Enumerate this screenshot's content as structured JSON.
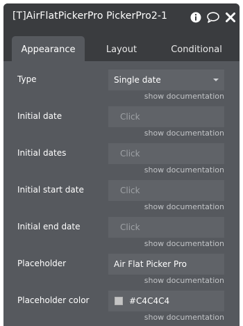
{
  "window": {
    "title": "[T]AirFlatPickerPro PickerPro2-1",
    "icons": [
      "info-icon",
      "comment-icon",
      "close-icon"
    ]
  },
  "tabs": [
    {
      "label": "Appearance",
      "active": true
    },
    {
      "label": "Layout",
      "active": false
    },
    {
      "label": "Conditional",
      "active": false
    }
  ],
  "properties": {
    "type": {
      "label": "Type",
      "value": "Single date",
      "doc": "show documentation"
    },
    "initial_date": {
      "label": "Initial date",
      "placeholder": "Click",
      "doc": "show documentation"
    },
    "initial_dates": {
      "label": "Initial dates",
      "placeholder": "Click",
      "doc": "show documentation"
    },
    "initial_start_date": {
      "label": "Initial start date",
      "placeholder": "Click",
      "doc": "show documentation"
    },
    "initial_end_date": {
      "label": "Initial end date",
      "placeholder": "Click",
      "doc": "show documentation"
    },
    "placeholder": {
      "label": "Placeholder",
      "value": "Air Flat Picker Pro",
      "doc": "show documentation"
    },
    "placeholder_color": {
      "label": "Placeholder color",
      "value": "#C4C4C4",
      "swatch": "#C4C4C4",
      "doc": "show documentation"
    }
  },
  "colors": {
    "panel_bg": "#56595e",
    "header_bg": "#3a3c3f",
    "field_bg": "#606368"
  }
}
